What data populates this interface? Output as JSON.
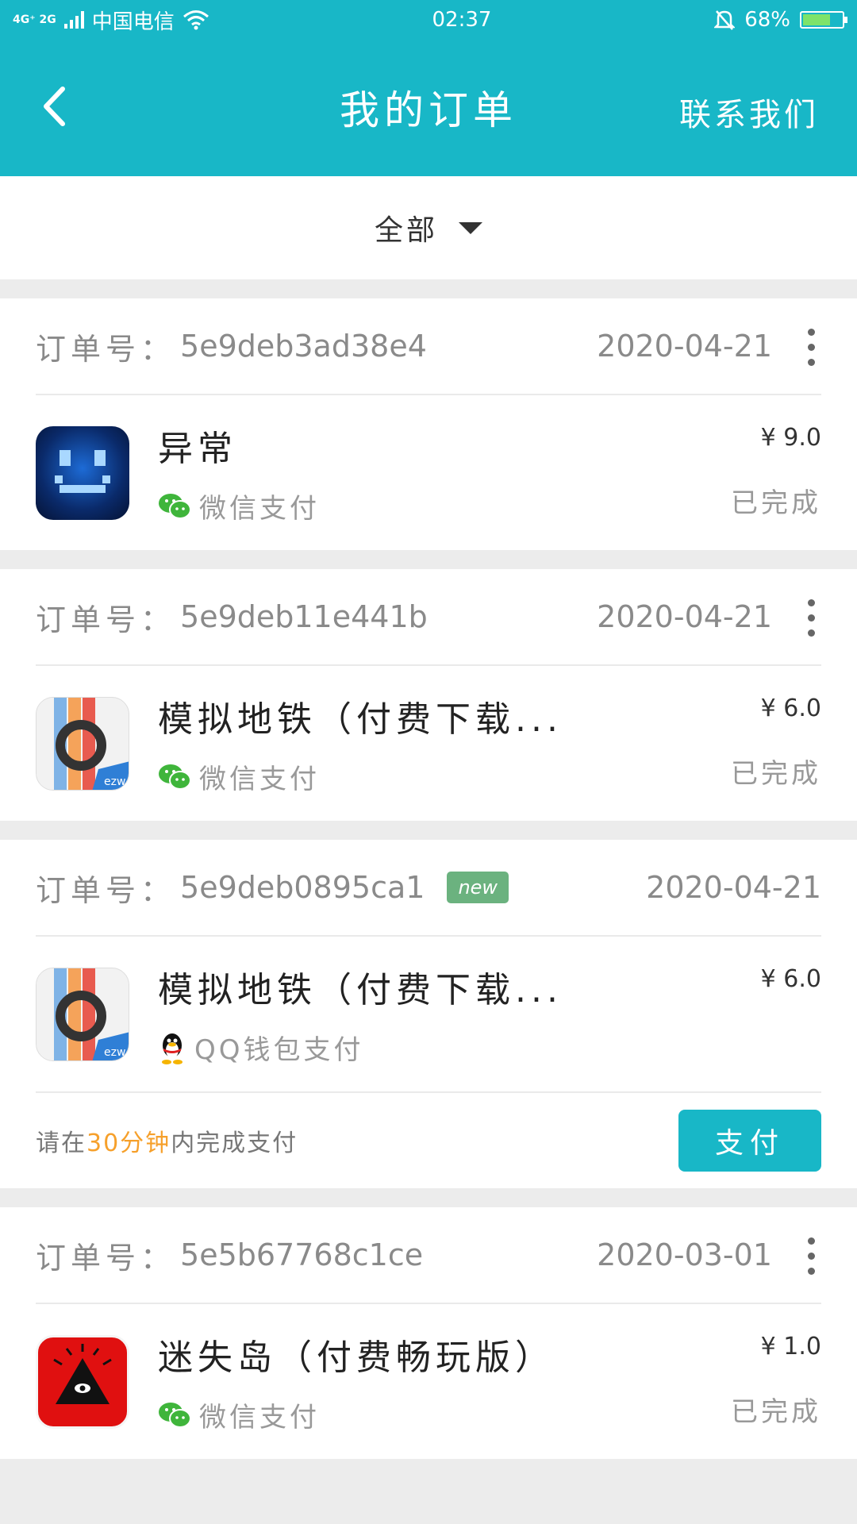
{
  "status_bar": {
    "network": "4G⁺ 2G",
    "carrier": "中国电信",
    "time": "02:37",
    "battery": "68%"
  },
  "header": {
    "title": "我的订单",
    "contact": "联系我们"
  },
  "filter": {
    "label": "全部"
  },
  "orders": [
    {
      "label": "订单号",
      "sep": "：",
      "id": "5e9deb3ad38e4",
      "badge": "",
      "date": "2020-04-21",
      "app": "异常",
      "payment": "微信支付",
      "price": "¥ 9.0",
      "status": "已完成"
    },
    {
      "label": "订单号",
      "sep": "：",
      "id": "5e9deb11e441b",
      "badge": "",
      "date": "2020-04-21",
      "app": "模拟地铁（付费下载...",
      "payment": "微信支付",
      "price": "¥ 6.0",
      "status": "已完成"
    },
    {
      "label": "订单号",
      "sep": "：",
      "id": "5e9deb0895ca1",
      "badge": "new",
      "date": "2020-04-21",
      "app": "模拟地铁（付费下载...",
      "payment": "QQ钱包支付",
      "price": "¥ 6.0",
      "status": "",
      "hint_pre": "请在",
      "hint_hl": "30分钟",
      "hint_post": "内完成支付",
      "pay_button": "支付"
    },
    {
      "label": "订单号",
      "sep": "：",
      "id": "5e5b67768c1ce",
      "badge": "",
      "date": "2020-03-01",
      "app": "迷失岛（付费畅玩版）",
      "payment": "微信支付",
      "price": "¥ 1.0",
      "status": "已完成"
    }
  ],
  "colors": {
    "primary": "#18b7c7",
    "highlight": "#f6a02b",
    "badge": "#6bb27f",
    "wechat": "#3fb53b"
  },
  "icons": {
    "back": "chevron-left-icon",
    "dropdown": "triangle-down-icon",
    "more": "more-vertical-icon",
    "wechat": "wechat-pay-icon",
    "qq": "qq-penguin-icon"
  }
}
